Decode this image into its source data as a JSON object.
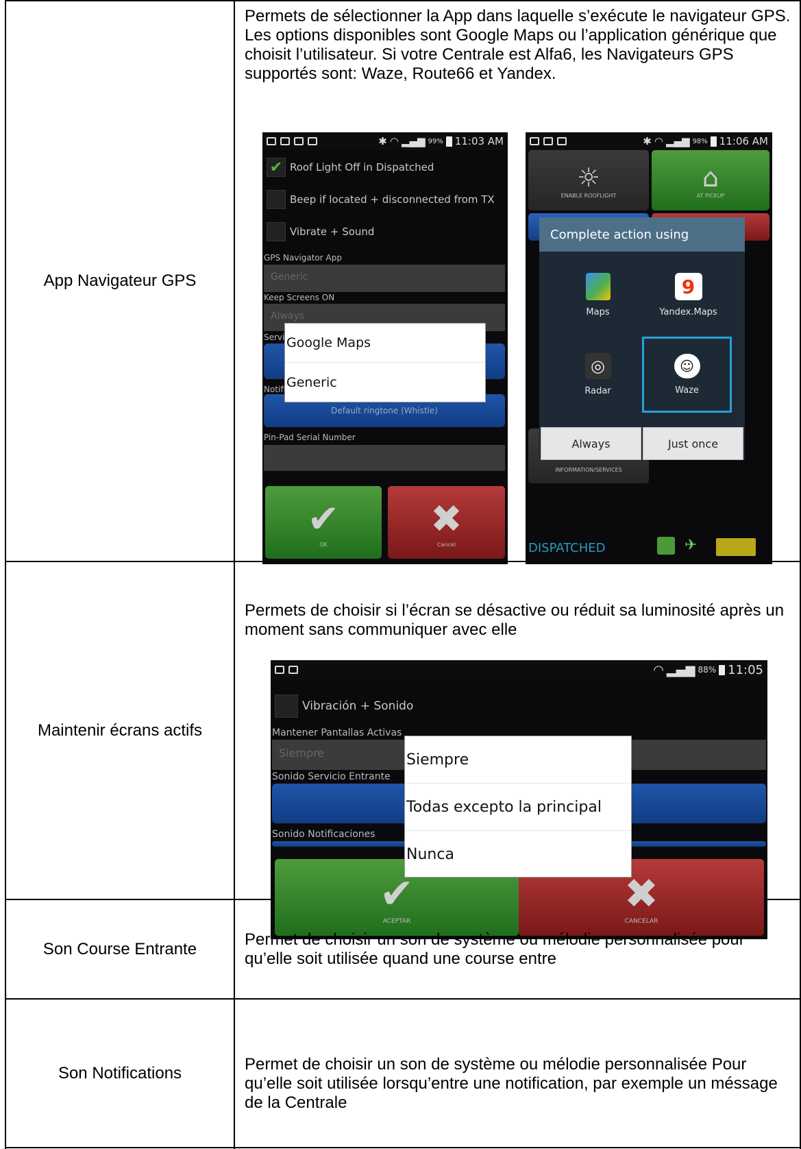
{
  "rows": [
    {
      "label": "App Navigateur GPS",
      "description": "Permets de sélectionner la App dans laquelle s’exécute le navigateur GPS. Les options disponibles sont Google Maps ou l’application générique que choisit l’utilisateur. Si votre Centrale est Alfa6, les Navigateurs GPS supportés sont: Waze, Route66 et Yandex."
    },
    {
      "label": "Maintenir écrans actifs",
      "description": "Permets de choisir si l’écran se désactive ou réduit sa luminosité après un moment sans communiquer avec elle"
    },
    {
      "label": "Son Course Entrante",
      "description": "Permet de choisir un son de système ou mélodie personnalisée pour qu’elle soit utilisée quand une course entre"
    },
    {
      "label": "Son Notifications",
      "description": "Permet de choisir un son de système ou mélodie personnalisée Pour qu’elle soit utilisée lorsqu’entre une notification, par exemple un méssage de la Centrale"
    }
  ],
  "screen1": {
    "status_battery": "99%",
    "status_time": "11:03 AM",
    "settings": [
      "Roof Light Off in Dispatched",
      "Beep if located + disconnected from TX",
      "Vibrate + Sound"
    ],
    "gps_label": "GPS Navigator App",
    "gps_value": "Generic",
    "keep_label": "Keep Screens ON",
    "keep_value": "Always",
    "service_label_partial": "Servi",
    "notif_label_partial": "Notifi",
    "ringtone": "Default ringtone (Whistle)",
    "pinpad_label": "Pin-Pad Serial Number",
    "popup_options": [
      "Google Maps",
      "Generic"
    ],
    "ok_label": "OK",
    "cancel_label": "Cancel"
  },
  "screen2": {
    "status_battery": "98%",
    "status_time": "11:06 AM",
    "tile_enable": "ENABLE ROOFLIGHT",
    "tile_pickup": "AT PICKUP",
    "tile_info": "INFORMATION/SERVICES",
    "dialog_title": "Complete action using",
    "apps": [
      "Maps",
      "Yandex.Maps",
      "Radar",
      "Waze"
    ],
    "btn_always": "Always",
    "btn_once": "Just once",
    "status_word": "DISPATCHED"
  },
  "screen3": {
    "status_battery": "88%",
    "status_time": "11:05",
    "vibrate_label": "Vibración + Sonido",
    "keep_label": "Mantener Pantallas Activas",
    "keep_value": "Siempre",
    "service_label": "Sonido Servicio Entrante",
    "notif_label": "Sonido Notificaciones",
    "popup_options": [
      "Siempre",
      "Todas excepto la principal",
      "Nunca"
    ],
    "accept_label": "ACEPTAR",
    "cancel_label": "CANCELAR"
  },
  "colors": {
    "accent_blue": "#2ba0d8",
    "check_green": "#58b83a"
  }
}
